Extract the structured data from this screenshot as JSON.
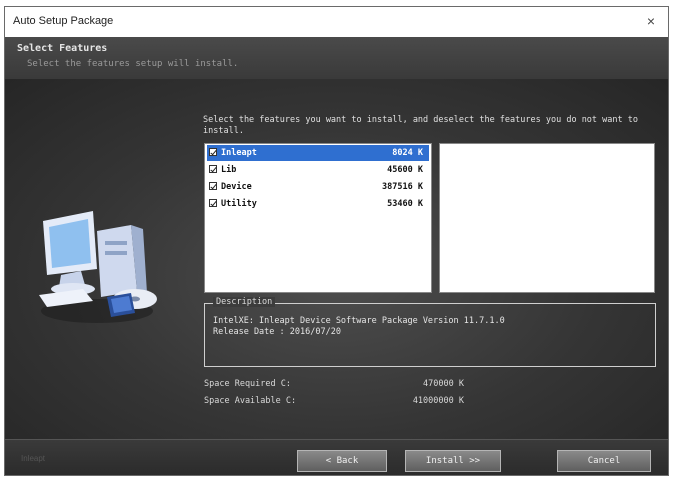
{
  "window": {
    "title": "Auto Setup Package",
    "close_glyph": "×"
  },
  "header": {
    "title": "Select Features",
    "subtitle": "Select the features setup will install."
  },
  "instructions": "Select the features you want to install, and deselect the features you do not want to install.",
  "features": [
    {
      "name": "Inleapt",
      "size": "8024 K",
      "checked": true,
      "selected": true
    },
    {
      "name": "Lib",
      "size": "45600 K",
      "checked": true,
      "selected": false
    },
    {
      "name": "Device",
      "size": "387516 K",
      "checked": true,
      "selected": false
    },
    {
      "name": "Utility",
      "size": "53460 K",
      "checked": true,
      "selected": false
    }
  ],
  "description": {
    "legend": "Description",
    "line1": "IntelXE: Inleapt Device Software Package Version 11.7.1.0",
    "line2": "Release Date : 2016/07/20"
  },
  "space": {
    "required_label": "Space Required  C:",
    "required_value": "470000 K",
    "available_label": "Space Available C:",
    "available_value": "41000000 K"
  },
  "footer": {
    "brand": "Inleapt",
    "back_label": "< Back",
    "install_label": "Install >>",
    "cancel_label": "Cancel"
  },
  "colors": {
    "selection": "#2f6fd0",
    "window_bg": "#2b2b2b"
  }
}
